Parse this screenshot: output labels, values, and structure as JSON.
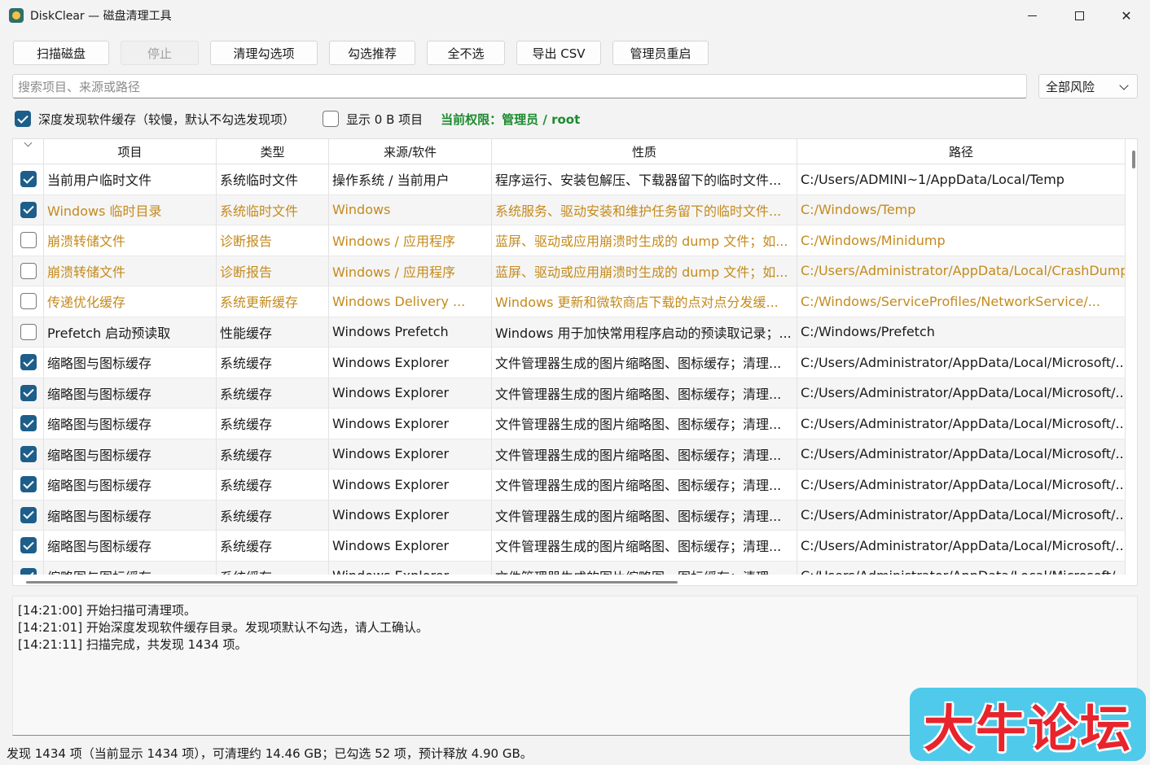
{
  "window": {
    "title": "DiskClear — 磁盘清理工具"
  },
  "toolbar": {
    "buttons": [
      {
        "label": "扫描磁盘",
        "disabled": false
      },
      {
        "label": "停止",
        "disabled": true
      },
      {
        "label": "清理勾选项",
        "disabled": false
      },
      {
        "label": "勾选推荐",
        "disabled": false
      },
      {
        "label": "全不选",
        "disabled": false
      },
      {
        "label": "导出 CSV",
        "disabled": false
      },
      {
        "label": "管理员重启",
        "disabled": false
      }
    ]
  },
  "search": {
    "placeholder": "搜索项目、来源或路径",
    "risk_filter": "全部风险"
  },
  "options": {
    "deep_scan_label": "深度发现软件缓存（较慢，默认不勾选发现项）",
    "deep_scan_checked": true,
    "show_zero_label": "显示 0 B 项目",
    "show_zero_checked": false,
    "permission_text": "当前权限：管理员 / root"
  },
  "table": {
    "columns": [
      "项目",
      "类型",
      "来源/软件",
      "性质",
      "路径"
    ],
    "rows": [
      {
        "checked": true,
        "warn": false,
        "item": "当前用户临时文件",
        "type": "系统临时文件",
        "source": "操作系统 / 当前用户",
        "nature": "程序运行、安装包解压、下载器留下的临时文件...",
        "path": "C:/Users/ADMINI~1/AppData/Local/Temp"
      },
      {
        "checked": true,
        "warn": true,
        "item": "Windows 临时目录",
        "type": "系统临时文件",
        "source": "Windows",
        "nature": "系统服务、驱动安装和维护任务留下的临时文件...",
        "path": "C:/Windows/Temp"
      },
      {
        "checked": false,
        "warn": true,
        "item": "崩溃转储文件",
        "type": "诊断报告",
        "source": "Windows / 应用程序",
        "nature": "蓝屏、驱动或应用崩溃时生成的 dump 文件；如...",
        "path": "C:/Windows/Minidump"
      },
      {
        "checked": false,
        "warn": true,
        "item": "崩溃转储文件",
        "type": "诊断报告",
        "source": "Windows / 应用程序",
        "nature": "蓝屏、驱动或应用崩溃时生成的 dump 文件；如...",
        "path": "C:/Users/Administrator/AppData/Local/CrashDump"
      },
      {
        "checked": false,
        "warn": true,
        "item": "传递优化缓存",
        "type": "系统更新缓存",
        "source": "Windows Delivery ...",
        "nature": "Windows 更新和微软商店下载的点对点分发缓...",
        "path": "C:/Windows/ServiceProfiles/NetworkService/..."
      },
      {
        "checked": false,
        "warn": false,
        "item": "Prefetch 启动预读取",
        "type": "性能缓存",
        "source": "Windows Prefetch",
        "nature": "Windows 用于加快常用程序启动的预读取记录；...",
        "path": "C:/Windows/Prefetch"
      },
      {
        "checked": true,
        "warn": false,
        "item": "缩略图与图标缓存",
        "type": "系统缓存",
        "source": "Windows Explorer",
        "nature": "文件管理器生成的图片缩略图、图标缓存；清理...",
        "path": "C:/Users/Administrator/AppData/Local/Microsoft/..."
      },
      {
        "checked": true,
        "warn": false,
        "item": "缩略图与图标缓存",
        "type": "系统缓存",
        "source": "Windows Explorer",
        "nature": "文件管理器生成的图片缩略图、图标缓存；清理...",
        "path": "C:/Users/Administrator/AppData/Local/Microsoft/..."
      },
      {
        "checked": true,
        "warn": false,
        "item": "缩略图与图标缓存",
        "type": "系统缓存",
        "source": "Windows Explorer",
        "nature": "文件管理器生成的图片缩略图、图标缓存；清理...",
        "path": "C:/Users/Administrator/AppData/Local/Microsoft/..."
      },
      {
        "checked": true,
        "warn": false,
        "item": "缩略图与图标缓存",
        "type": "系统缓存",
        "source": "Windows Explorer",
        "nature": "文件管理器生成的图片缩略图、图标缓存；清理...",
        "path": "C:/Users/Administrator/AppData/Local/Microsoft/..."
      },
      {
        "checked": true,
        "warn": false,
        "item": "缩略图与图标缓存",
        "type": "系统缓存",
        "source": "Windows Explorer",
        "nature": "文件管理器生成的图片缩略图、图标缓存；清理...",
        "path": "C:/Users/Administrator/AppData/Local/Microsoft/..."
      },
      {
        "checked": true,
        "warn": false,
        "item": "缩略图与图标缓存",
        "type": "系统缓存",
        "source": "Windows Explorer",
        "nature": "文件管理器生成的图片缩略图、图标缓存；清理...",
        "path": "C:/Users/Administrator/AppData/Local/Microsoft/..."
      },
      {
        "checked": true,
        "warn": false,
        "item": "缩略图与图标缓存",
        "type": "系统缓存",
        "source": "Windows Explorer",
        "nature": "文件管理器生成的图片缩略图、图标缓存；清理...",
        "path": "C:/Users/Administrator/AppData/Local/Microsoft/..."
      },
      {
        "checked": true,
        "warn": false,
        "item": "缩略图与图标缓存",
        "type": "系统缓存",
        "source": "Windows Explorer",
        "nature": "文件管理器生成的图片缩略图、图标缓存；清理...",
        "path": "C:/Users/Administrator/AppData/Local/Microsoft/..."
      }
    ]
  },
  "log": [
    "[14:21:00] 开始扫描可清理项。",
    "[14:21:01] 开始深度发现软件缓存目录。发现项默认不勾选，请人工确认。",
    "[14:21:11] 扫描完成，共发现 1434 项。"
  ],
  "status": "发现 1434 项（当前显示 1434 项），可清理约 14.46 GB；已勾选 52 项，预计释放 4.90 GB。",
  "watermark": "大牛论坛",
  "colors": {
    "accent": "#1d5e8a",
    "warn_text": "#c48a1c",
    "permission": "#1b8a2e",
    "watermark_bg": "#4fcaea",
    "watermark_text": "#e8242c"
  }
}
